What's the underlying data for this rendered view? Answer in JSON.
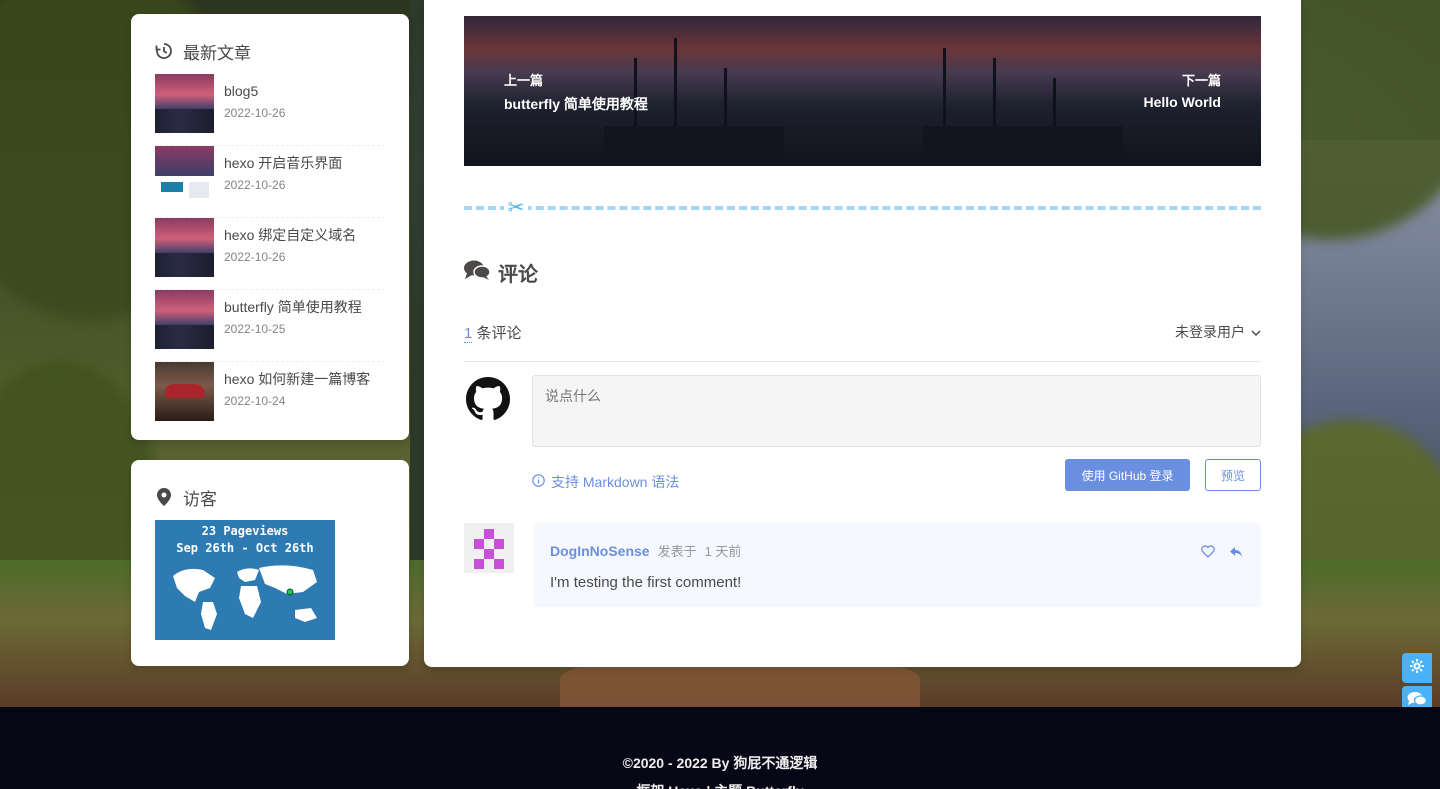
{
  "recent_posts": {
    "title": "最新文章",
    "items": [
      {
        "title": "blog5",
        "date": "2022-10-26",
        "thumb": "sunset-ships"
      },
      {
        "title": "hexo 开启音乐界面",
        "date": "2022-10-26",
        "thumb": "site-screenshot"
      },
      {
        "title": "hexo 绑定自定义域名",
        "date": "2022-10-26",
        "thumb": "sunset-ships"
      },
      {
        "title": "butterfly 简单使用教程",
        "date": "2022-10-25",
        "thumb": "sunset-ships"
      },
      {
        "title": "hexo 如何新建一篇博客",
        "date": "2022-10-24",
        "thumb": "red-car"
      }
    ]
  },
  "visitors": {
    "title": "访客",
    "map_line1": "23 Pageviews",
    "map_line2": "Sep 26th - Oct 26th"
  },
  "pagination": {
    "prev_label": "上一篇",
    "prev_title": "butterfly 简单使用教程",
    "next_label": "下一篇",
    "next_title": "Hello World"
  },
  "comments": {
    "heading": "评论",
    "count": "1",
    "count_suffix": "条评论",
    "login_state": "未登录用户",
    "placeholder": "说点什么",
    "markdown_tip": "支持 Markdown 语法",
    "login_button": "使用 GitHub 登录",
    "preview_button": "预览",
    "items": [
      {
        "author": "DogInNoSense",
        "posted": "发表于",
        "time": "1 天前",
        "text": "I'm testing the first comment!"
      }
    ]
  },
  "footer": {
    "line1": "©2020 - 2022 By 狗屁不通逻辑",
    "line2": "框架 Hexo | 主题 Butterfly"
  },
  "colors": {
    "accent": "#6a8fe0",
    "side_button": "#49b1f5",
    "divider": "#a5d6f5",
    "footer_bg": "#070716"
  },
  "side_buttons": [
    "gear-icon",
    "comments-icon",
    "arrow-up-icon"
  ]
}
